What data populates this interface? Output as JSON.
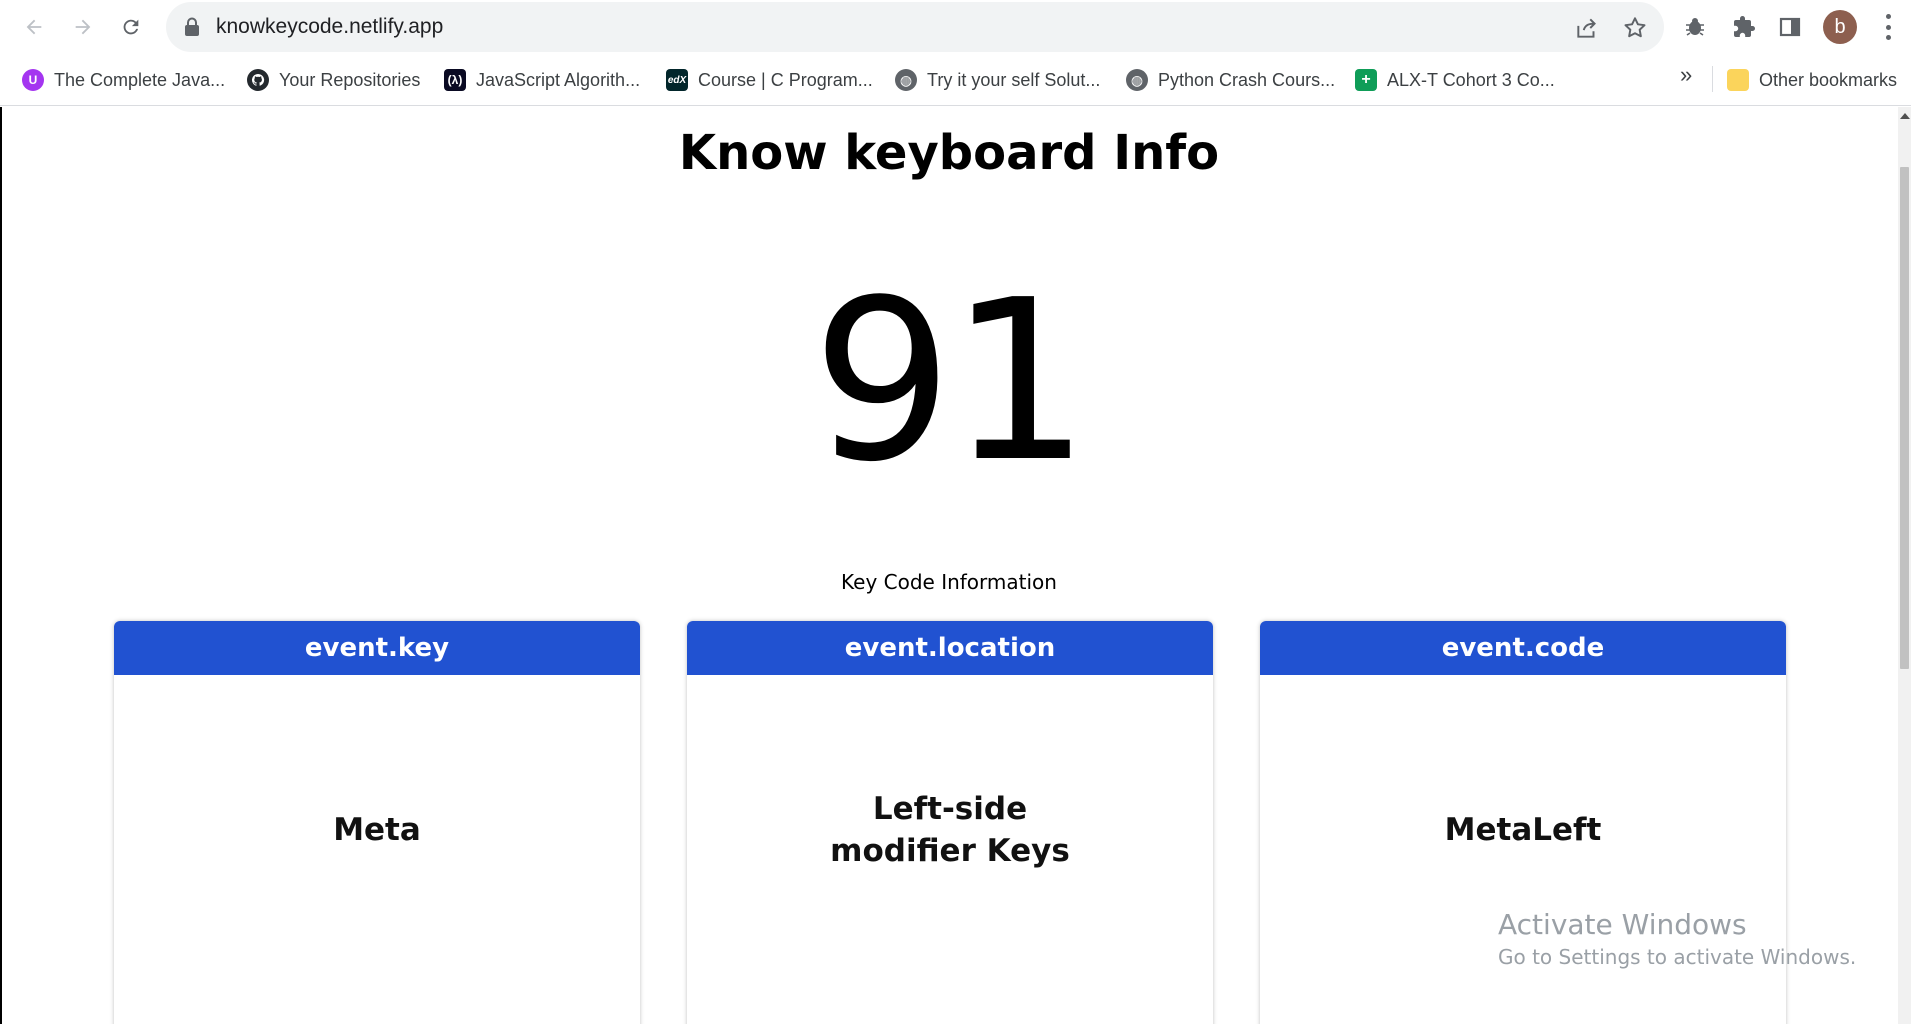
{
  "browser": {
    "url": "knowkeycode.netlify.app",
    "avatar_letter": "b"
  },
  "bookmarks": {
    "items": [
      {
        "label": "The Complete Java...",
        "icon": "udemy-icon",
        "color": "#a435f0"
      },
      {
        "label": "Your Repositories",
        "icon": "github-icon",
        "color": "#24292e"
      },
      {
        "label": "JavaScript Algorith...",
        "icon": "freecodecamp-icon",
        "color": "#0a0a23"
      },
      {
        "label": "Course | C Program...",
        "icon": "edx-icon",
        "color": "#02262b"
      },
      {
        "label": "Try it your self Solut...",
        "icon": "globe-icon",
        "color": "#5f6368"
      },
      {
        "label": "Python Crash Cours...",
        "icon": "globe-icon",
        "color": "#5f6368"
      },
      {
        "label": "ALX-T Cohort 3 Co...",
        "icon": "sheets-icon",
        "color": "#0f9d58"
      }
    ],
    "overflow": "»",
    "other_label": "Other bookmarks"
  },
  "page": {
    "title": "Know keyboard Info",
    "keycode": "91",
    "info_label": "Key Code Information",
    "cards": [
      {
        "header": "event.key",
        "value": "Meta"
      },
      {
        "header": "event.location",
        "value_line1": "Left-side",
        "value_line2": "modifier Keys"
      },
      {
        "header": "event.code",
        "value": "MetaLeft"
      }
    ],
    "accent_color": "#2152d1"
  },
  "watermark": {
    "title": "Activate Windows",
    "subtitle": "Go to Settings to activate Windows."
  }
}
